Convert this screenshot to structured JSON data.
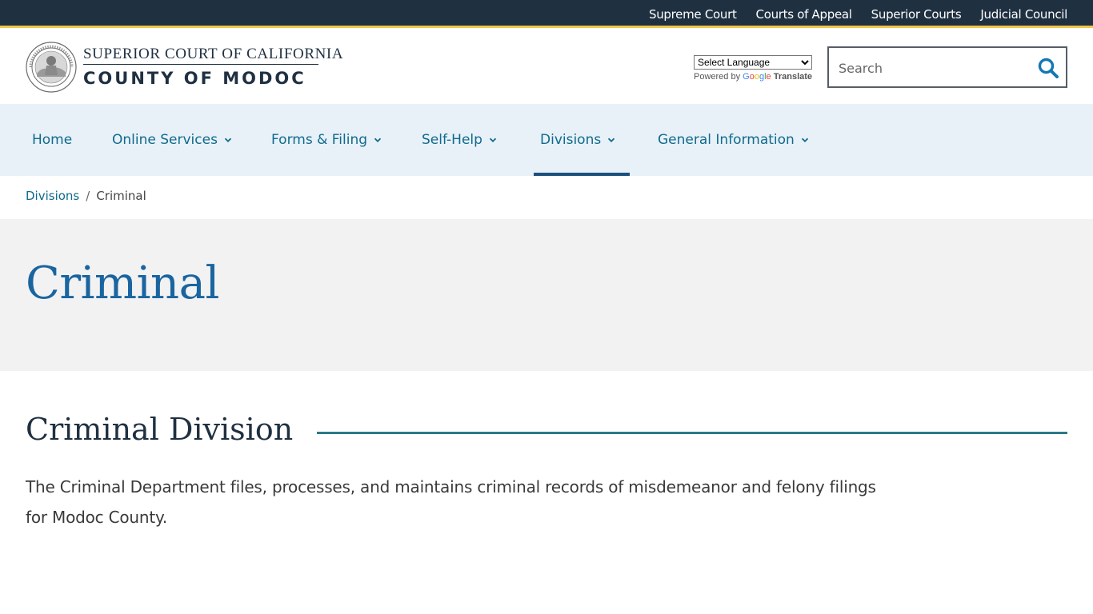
{
  "utility_nav": {
    "links": [
      "Supreme Court",
      "Courts of Appeal",
      "Superior Courts",
      "Judicial Council"
    ]
  },
  "header": {
    "court_name_line1": "SUPERIOR COURT OF CALIFORNIA",
    "court_name_line2": "COUNTY OF MODOC",
    "translate": {
      "select_label": "Select Language",
      "powered_by": "Powered by",
      "google_letters": [
        "G",
        "o",
        "o",
        "g",
        "l",
        "e"
      ],
      "translate_label": "Translate"
    },
    "search": {
      "placeholder": "Search"
    }
  },
  "main_nav": {
    "items": [
      {
        "label": "Home",
        "has_dropdown": false
      },
      {
        "label": "Online Services",
        "has_dropdown": true
      },
      {
        "label": "Forms & Filing",
        "has_dropdown": true
      },
      {
        "label": "Self-Help",
        "has_dropdown": true
      },
      {
        "label": "Divisions",
        "has_dropdown": true,
        "active": true
      },
      {
        "label": "General Information",
        "has_dropdown": true
      }
    ]
  },
  "breadcrumb": {
    "parent": "Divisions",
    "separator": "/",
    "current": "Criminal"
  },
  "page": {
    "title": "Criminal",
    "section_title": "Criminal Division",
    "body": "The Criminal Department files, processes, and maintains criminal records of misdemeanor and felony filings for Modoc County."
  },
  "colors": {
    "utility_bar": "#1f3041",
    "accent_gold": "#f0c64a",
    "nav_bg": "#e8f1f8",
    "link": "#106a8c",
    "title_blue": "#1a65a0",
    "rule_teal": "#2a7a88"
  },
  "icons": {
    "seal": "california-judicial-seal-icon",
    "search": "search-icon",
    "dropdown": "chevron-down-icon"
  }
}
